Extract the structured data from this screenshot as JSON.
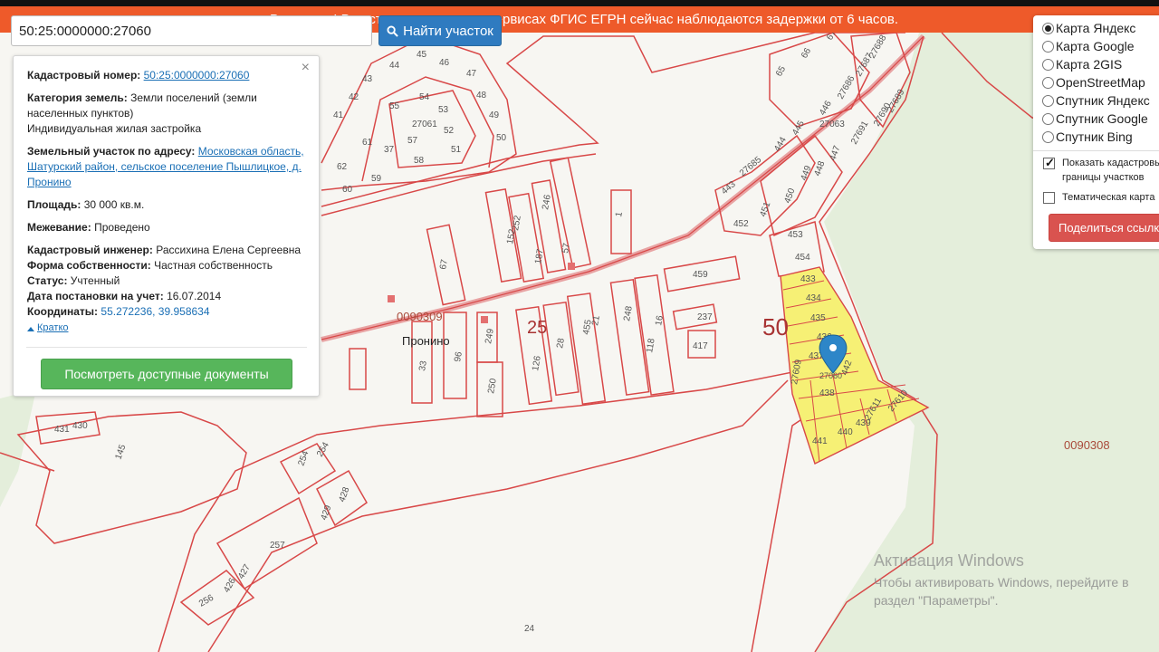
{
  "banner": {
    "text": "Внимание! В настоящее время на сервисах ФГИС ЕГРН сейчас наблюдаются задержки от 6 часов."
  },
  "search": {
    "value": "50:25:0000000:27060",
    "button_label": "Найти участок"
  },
  "info_panel": {
    "close_label": "×",
    "cadastral_label": "Кадастровый номер:",
    "cadastral_value": "50:25:0000000:27060",
    "category_label": "Категория земель:",
    "category_value": "Земли поселений (земли населенных пунктов)",
    "permitted_use": "Индивидуальная жилая застройка",
    "address_label": "Земельный участок по адресу:",
    "address_value": "Московская область, Шатурский район, сельское поселение Пышлицкое, д. Пронино",
    "area_label": "Площадь:",
    "area_value": "30 000 кв.м.",
    "survey_label": "Межевание:",
    "survey_value": "Проведено",
    "engineer_label": "Кадастровый инженер:",
    "engineer_value": "Рассихина Елена Сергеевна",
    "ownership_label": "Форма собственности:",
    "ownership_value": "Частная собственность",
    "status_label": "Статус:",
    "status_value": "Учтенный",
    "reg_date_label": "Дата постановки на учет:",
    "reg_date_value": "16.07.2014",
    "coords_label": "Координаты:",
    "coords_value": "55.272236, 39.958634",
    "collapse_label": "Кратко",
    "docs_button": "Посмотреть доступные документы"
  },
  "layers": {
    "options": [
      {
        "label": "Карта Яндекс",
        "selected": true
      },
      {
        "label": "Карта Google",
        "selected": false
      },
      {
        "label": "Карта 2GIS",
        "selected": false
      },
      {
        "label": "OpenStreetMap",
        "selected": false
      },
      {
        "label": "Спутник Яндекс",
        "selected": false
      },
      {
        "label": "Спутник Google",
        "selected": false
      },
      {
        "label": "Спутник Bing",
        "selected": false
      }
    ],
    "show_borders_label_1": "Показать кадастровые",
    "show_borders_label_2": "границы участков",
    "show_borders_checked": true,
    "thematic_label": "Тематическая карта",
    "thematic_checked": false,
    "share_button": "Поделиться ссылкой"
  },
  "map": {
    "village_name": "Пронино",
    "block_code_west": "0090309",
    "block_code_east": "0090308",
    "district_25": "25",
    "district_50": "50",
    "sheet_24": "24",
    "selected_marker_label": "27060",
    "colors": {
      "border": "#d84848",
      "selected_fill": "#f5f07a",
      "forest": "#e6efdc",
      "background": "#f7f6f2"
    }
  },
  "watermark": {
    "title": "Активация Windows",
    "line": "Чтобы активировать Windows, перейдите в раздел \"Параметры\"."
  }
}
